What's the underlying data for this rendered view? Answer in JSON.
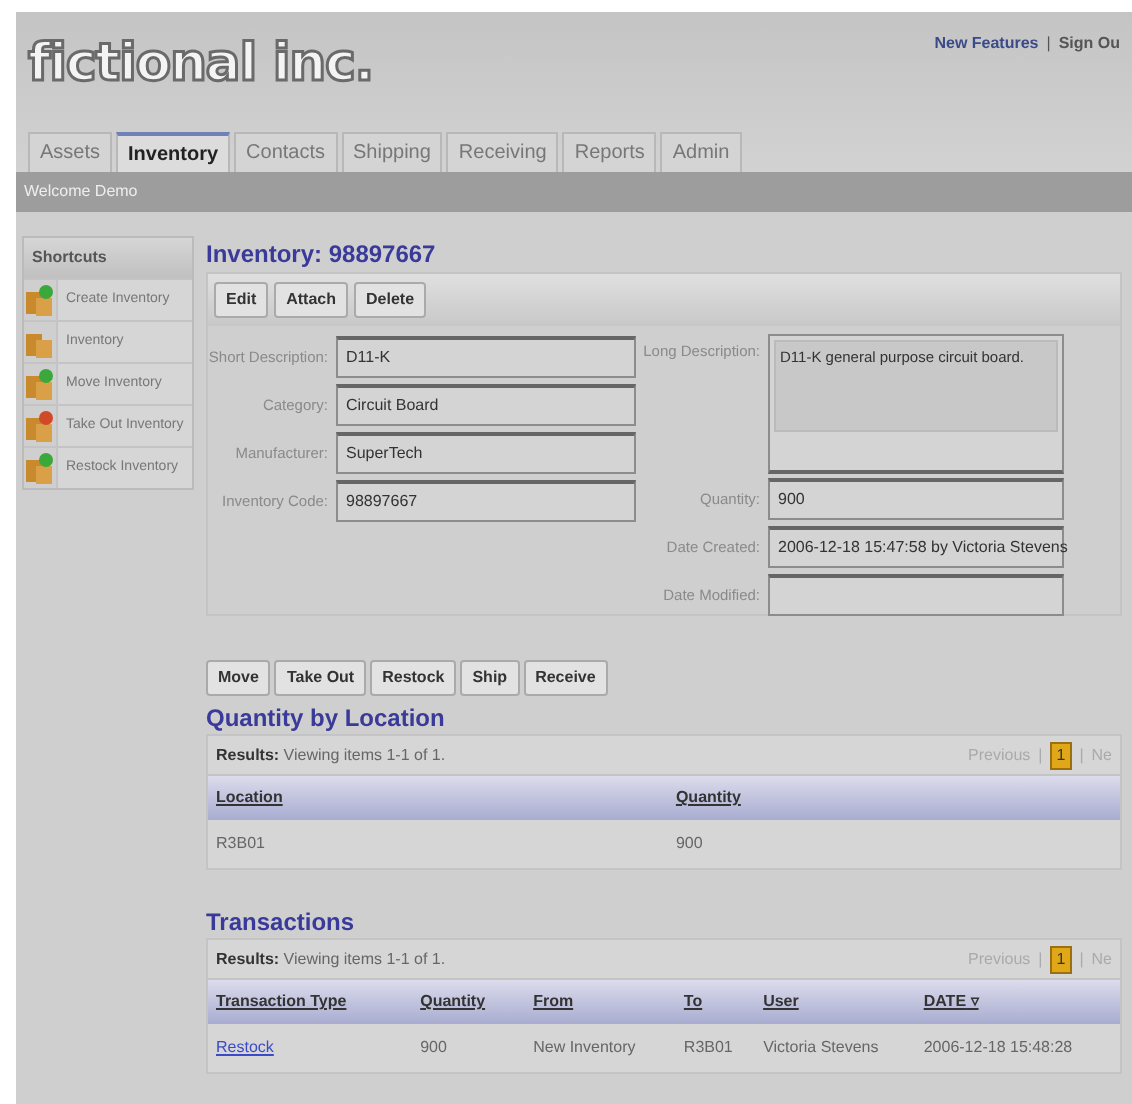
{
  "header": {
    "logo": "fictional inc.",
    "links": [
      "New Features",
      "Sign Ou"
    ],
    "separator": "|"
  },
  "tabs": [
    {
      "label": "Assets",
      "selected": false
    },
    {
      "label": "Inventory",
      "selected": true
    },
    {
      "label": "Contacts",
      "selected": false
    },
    {
      "label": "Shipping",
      "selected": false
    },
    {
      "label": "Receiving",
      "selected": false
    },
    {
      "label": "Reports",
      "selected": false
    },
    {
      "label": "Admin",
      "selected": false
    }
  ],
  "welcome": "Welcome Demo",
  "sidebar": {
    "title": "Shortcuts",
    "items": [
      {
        "label": "Create Inventory",
        "color": "#3aa83a"
      },
      {
        "label": "Inventory"
      },
      {
        "label": "Move Inventory",
        "color": "#3aa83a"
      },
      {
        "label": "Take Out Inventory",
        "color": "#d04a2a"
      },
      {
        "label": "Restock Inventory",
        "color": "#3aa83a"
      }
    ]
  },
  "title": "Inventory: 98897667",
  "toolbar": [
    "Edit",
    "Attach",
    "Delete"
  ],
  "left_fields": [
    {
      "label": "Short Description:",
      "value": "D11-K"
    },
    {
      "label": "Category:",
      "value": "Circuit Board"
    },
    {
      "label": "Manufacturer:",
      "value": "SuperTech"
    },
    {
      "label": "Inventory Code:",
      "value": "98897667"
    }
  ],
  "long_description": {
    "label": "Long Description:",
    "value": "D11-K general purpose circuit board."
  },
  "right_fields": [
    {
      "label": "Quantity:",
      "value": "900"
    },
    {
      "label": "Date Created:",
      "value": "2006-12-18 15:47:58 by Victoria Stevens"
    },
    {
      "label": "Date Modified:"
    }
  ],
  "actions": [
    "Move",
    "Take Out",
    "Restock",
    "Ship",
    "Receive"
  ],
  "sections": [
    {
      "title": "Quantity by Location",
      "results_label": "Results:",
      "results": "Viewing items 1-1 of 1.",
      "pager": {
        "previous": "Previous",
        "separator": "|",
        "pages": [
          {
            "label": "1",
            "selected": true
          }
        ],
        "next": "Ne"
      },
      "columns": [
        "Location",
        "Quantity"
      ],
      "rows": [
        [
          {
            "text": "R3B01"
          },
          {
            "text": "900"
          }
        ]
      ]
    },
    {
      "title": "Transactions",
      "results_label": "Results:",
      "results": "Viewing items 1-1 of 1.",
      "pager": {
        "previous": "Previous",
        "separator": "|",
        "pages": [
          {
            "label": "1",
            "selected": true
          }
        ],
        "next": "Ne"
      },
      "columns": [
        "Transaction Type",
        "Quantity",
        "From",
        "To",
        "User",
        "DATE"
      ],
      "sort_mark": "▿",
      "rows": [
        [
          {
            "text": "Restock",
            "kind": "link"
          },
          {
            "text": "900"
          },
          {
            "text": "New Inventory"
          },
          {
            "text": "R3B01"
          },
          {
            "text": "Victoria Stevens"
          },
          {
            "text": "2006-12-18 15:48:28"
          }
        ]
      ]
    }
  ]
}
